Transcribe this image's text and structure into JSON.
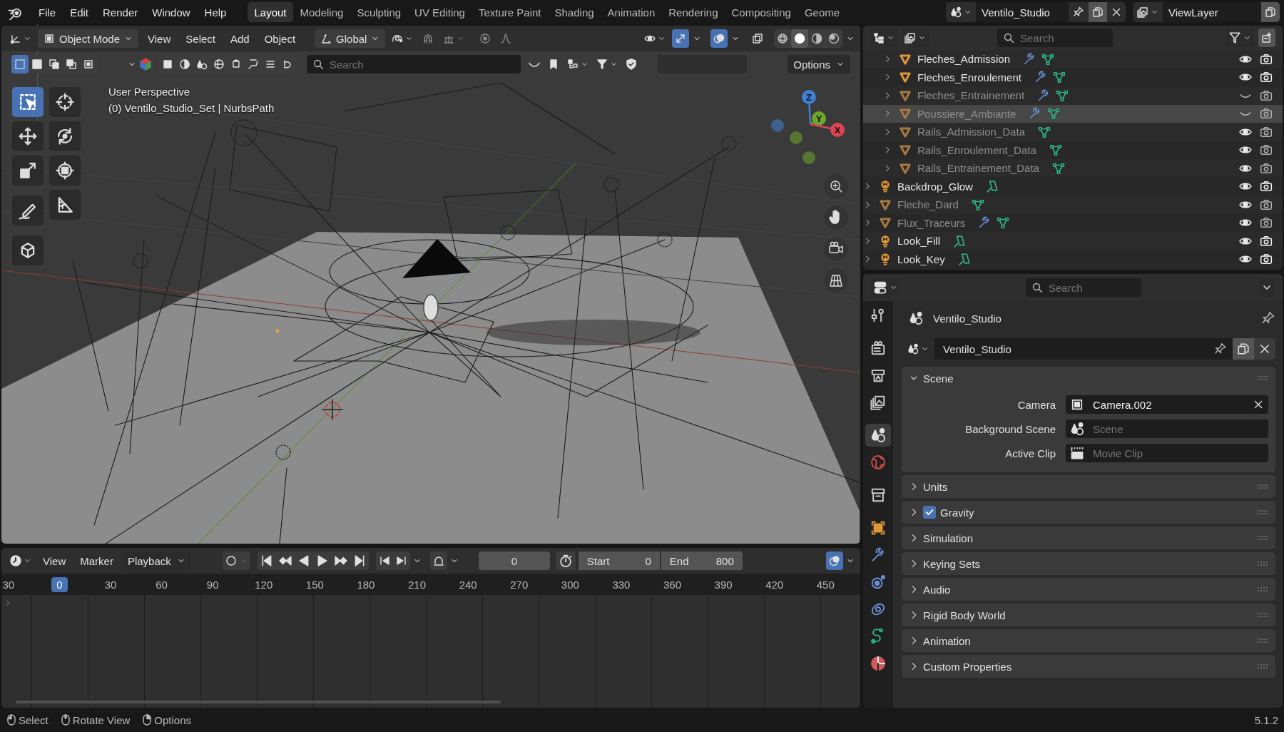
{
  "top_bar": {
    "menus": [
      "File",
      "Edit",
      "Render",
      "Window",
      "Help"
    ],
    "workspaces": [
      {
        "label": "Layout",
        "selected": true
      },
      {
        "label": "Modeling",
        "selected": false
      },
      {
        "label": "Sculpting",
        "selected": false
      },
      {
        "label": "UV Editing",
        "selected": false
      },
      {
        "label": "Texture Paint",
        "selected": false
      },
      {
        "label": "Shading",
        "selected": false
      },
      {
        "label": "Animation",
        "selected": false
      },
      {
        "label": "Rendering",
        "selected": false
      },
      {
        "label": "Compositing",
        "selected": false
      },
      {
        "label": "Geome",
        "selected": false
      }
    ],
    "scene": "Ventilo_Studio",
    "view_layer": "ViewLayer"
  },
  "viewport": {
    "mode": "Object Mode",
    "menus": [
      "View",
      "Select",
      "Add",
      "Object"
    ],
    "orientation": "Global",
    "shading_modes": [
      {
        "kind": "wireframe",
        "selected": false
      },
      {
        "kind": "solid",
        "selected": true
      },
      {
        "kind": "material",
        "selected": false
      },
      {
        "kind": "rendered",
        "selected": false
      }
    ],
    "search": {
      "placeholder": "Search"
    },
    "options": "Options",
    "info": [
      "User Perspective",
      "(0) Ventilo_Studio_Set | NurbsPath"
    ],
    "tools": [
      {
        "kind": "select",
        "selected": true
      },
      {
        "kind": "cursor",
        "selected": false
      },
      {
        "kind": "move",
        "selected": false
      },
      {
        "kind": "rotate",
        "selected": false
      },
      {
        "kind": "scale",
        "selected": false
      },
      {
        "kind": "transform",
        "selected": false
      },
      {
        "kind": "annotate",
        "selected": false
      },
      {
        "kind": "measure",
        "selected": false
      },
      {
        "kind": "add-cube",
        "selected": false
      }
    ],
    "gizmo_axes": [
      "Z",
      "Y",
      "X"
    ]
  },
  "timeline": {
    "menus": [
      "View",
      "Marker"
    ],
    "playback": "Playback",
    "current_frame": "0",
    "start_label": "Start",
    "start": "0",
    "end_label": "End",
    "end": "800",
    "ruler": [
      {
        "label": "30",
        "current": false
      },
      {
        "label": "0",
        "current": true
      },
      {
        "label": "30",
        "current": false
      },
      {
        "label": "60",
        "current": false
      },
      {
        "label": "90",
        "current": false
      },
      {
        "label": "120",
        "current": false
      },
      {
        "label": "150",
        "current": false
      },
      {
        "label": "180",
        "current": false
      },
      {
        "label": "210",
        "current": false
      },
      {
        "label": "240",
        "current": false
      },
      {
        "label": "270",
        "current": false
      },
      {
        "label": "300",
        "current": false
      },
      {
        "label": "330",
        "current": false
      },
      {
        "label": "360",
        "current": false
      },
      {
        "label": "390",
        "current": false
      },
      {
        "label": "420",
        "current": false
      },
      {
        "label": "450",
        "current": false
      }
    ]
  },
  "outliner": {
    "search": {
      "placeholder": "Search"
    },
    "items": [
      {
        "children": [
          {
            "name": "Fleches_Admission",
            "kind": "mesh",
            "dimmed": false,
            "modifier": true,
            "visible": true,
            "selected": false
          },
          {
            "name": "Fleches_Enroulement",
            "kind": "mesh",
            "dimmed": false,
            "modifier": true,
            "visible": true,
            "selected": false
          },
          {
            "name": "Fleches_Entrainement",
            "kind": "mesh",
            "dimmed": true,
            "modifier": true,
            "visible": false,
            "selected": false
          },
          {
            "name": "Poussiere_Ambiante",
            "kind": "mesh",
            "dimmed": true,
            "modifier": true,
            "visible": false,
            "selected": true
          },
          {
            "name": "Rails_Admission_Data",
            "kind": "mesh",
            "dimmed": true,
            "modifier": false,
            "visible": true,
            "selected": false
          },
          {
            "name": "Rails_Enroulement_Data",
            "kind": "mesh",
            "dimmed": true,
            "modifier": false,
            "visible": true,
            "selected": false
          },
          {
            "name": "Rails_Entrainement_Data",
            "kind": "mesh",
            "dimmed": true,
            "modifier": false,
            "visible": true,
            "selected": false
          }
        ]
      },
      {
        "name": "Backdrop_Glow",
        "kind": "light",
        "dimmed": false,
        "modifier": false,
        "visible": true,
        "selected": false
      },
      {
        "name": "Fleche_Dard",
        "kind": "mesh",
        "dimmed": true,
        "modifier": false,
        "visible": true,
        "selected": false
      },
      {
        "name": "Flux_Traceurs",
        "kind": "mesh",
        "dimmed": true,
        "modifier": true,
        "visible": true,
        "selected": false
      },
      {
        "name": "Look_Fill",
        "kind": "light",
        "dimmed": false,
        "modifier": false,
        "visible": true,
        "selected": false
      },
      {
        "name": "Look_Key",
        "kind": "light",
        "dimmed": false,
        "modifier": false,
        "visible": true,
        "selected": false
      }
    ]
  },
  "properties": {
    "search": {
      "placeholder": "Search"
    },
    "tabs": [
      {
        "kind": "tool",
        "selected": false
      },
      {
        "kind": "render",
        "selected": false
      },
      {
        "kind": "output",
        "selected": false
      },
      {
        "kind": "view-layer",
        "selected": false
      },
      {
        "kind": "scene",
        "selected": true
      },
      {
        "kind": "world",
        "selected": false
      },
      {
        "kind": "collection",
        "selected": false
      },
      {
        "kind": "object",
        "selected": false
      },
      {
        "kind": "modifiers",
        "selected": false
      },
      {
        "kind": "particles",
        "selected": false
      },
      {
        "kind": "physics",
        "selected": false
      },
      {
        "kind": "constraints",
        "selected": false
      },
      {
        "kind": "material",
        "selected": false
      }
    ],
    "context": "Ventilo_Studio",
    "datablock": "Ventilo_Studio",
    "panels": [
      {
        "title": "Scene",
        "kind": "plain",
        "expanded": true,
        "fields": [
          {
            "label": "Camera",
            "kind": "camera",
            "value": "Camera.002"
          },
          {
            "label": "Background Scene",
            "kind": "scene",
            "placeholder": "Scene"
          },
          {
            "label": "Active Clip",
            "kind": "clip",
            "placeholder": "Movie Clip"
          }
        ]
      },
      {
        "title": "Units",
        "kind": "plain",
        "expanded": false
      },
      {
        "title": "Gravity",
        "kind": "toggle",
        "checked": true,
        "expanded": false
      },
      {
        "title": "Simulation",
        "kind": "plain",
        "expanded": false
      },
      {
        "title": "Keying Sets",
        "kind": "plain",
        "expanded": false
      },
      {
        "title": "Audio",
        "kind": "plain",
        "expanded": false
      },
      {
        "title": "Rigid Body World",
        "kind": "plain",
        "expanded": false
      },
      {
        "title": "Animation",
        "kind": "plain",
        "expanded": false
      },
      {
        "title": "Custom Properties",
        "kind": "plain",
        "expanded": false
      }
    ]
  },
  "status_bar": {
    "hints": [
      "Select",
      "Rotate View",
      "Options"
    ],
    "version": "5.1.2"
  }
}
